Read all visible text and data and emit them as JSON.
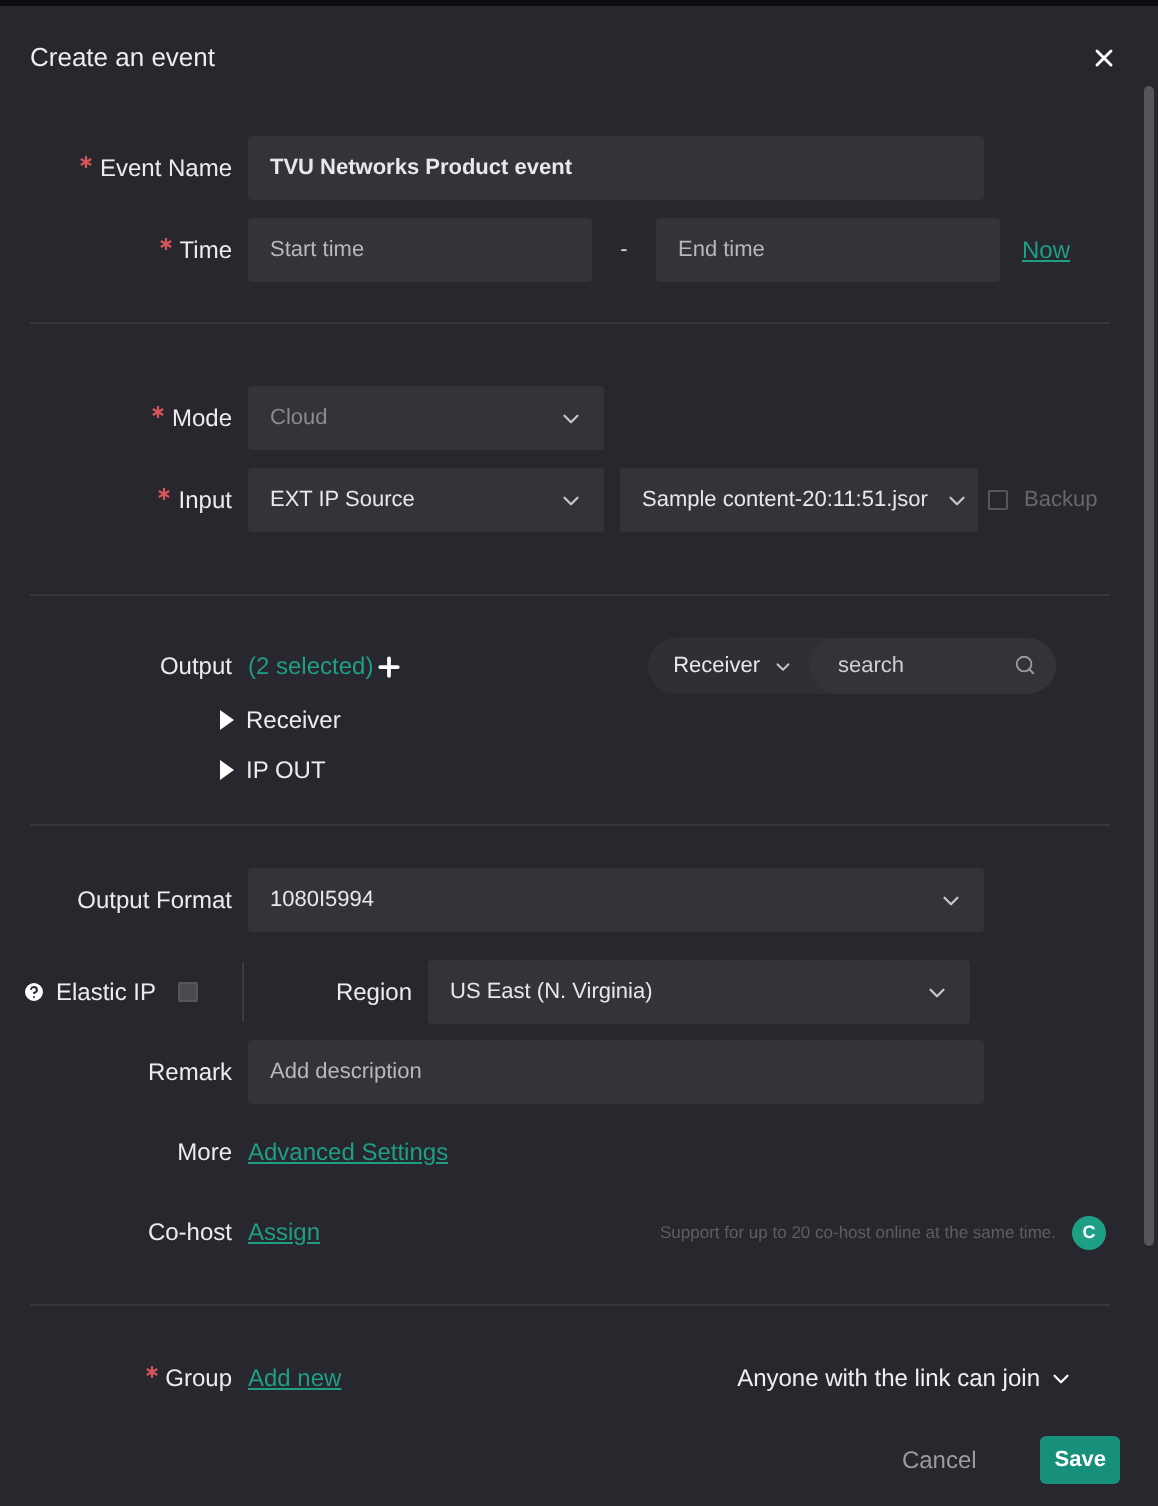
{
  "dialog": {
    "title": "Create an event"
  },
  "event_name": {
    "label": "Event Name",
    "required": true,
    "value": "TVU Networks Product event"
  },
  "time": {
    "label": "Time",
    "required": true,
    "start_placeholder": "Start time",
    "separator": "-",
    "end_placeholder": "End time",
    "now_link": "Now"
  },
  "mode": {
    "label": "Mode",
    "required": true,
    "value": "Cloud",
    "disabled": true
  },
  "input": {
    "label": "Input",
    "required": true,
    "source": "EXT IP Source",
    "content": "Sample content-20:11:51.jsor",
    "backup": {
      "label": "Backup",
      "checked": false,
      "disabled": true
    }
  },
  "output": {
    "label": "Output",
    "required": false,
    "count": "(2 selected)",
    "filter": "Receiver",
    "search_placeholder": "search",
    "tree": [
      {
        "label": "Receiver",
        "expanded": false
      },
      {
        "label": "IP OUT",
        "expanded": false
      }
    ]
  },
  "output_format": {
    "label": "Output Format",
    "required": false,
    "value": "1080I5994"
  },
  "elastic_ip": {
    "label": "Elastic IP",
    "checked": false,
    "disabled": true
  },
  "region": {
    "label": "Region",
    "value": "US East (N. Virginia)"
  },
  "remark": {
    "label": "Remark",
    "required": false,
    "placeholder": "Add description"
  },
  "more": {
    "label": "More",
    "link": "Advanced Settings"
  },
  "cohost": {
    "label": "Co-host",
    "link": "Assign",
    "hint": "Support for up to 20 co-host online at the same time.",
    "avatar": "C"
  },
  "group": {
    "label": "Group",
    "required": true,
    "link": "Add new",
    "access": "Anyone with the link can join"
  },
  "buttons": {
    "cancel": "Cancel",
    "save": "Save"
  }
}
